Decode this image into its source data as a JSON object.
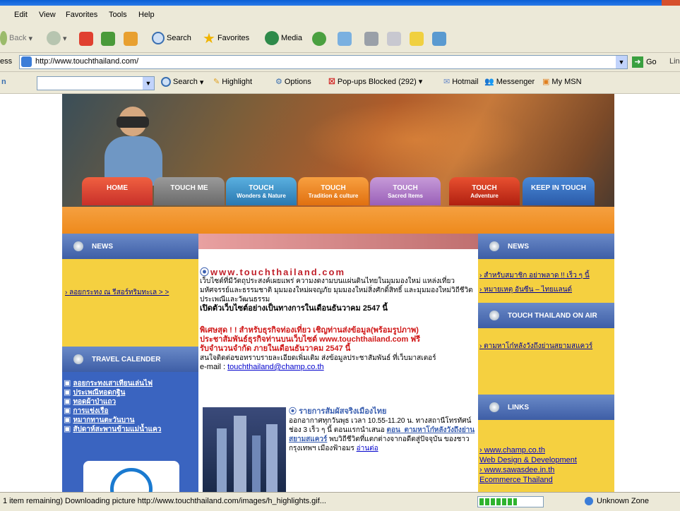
{
  "menu": [
    "Edit",
    "View",
    "Favorites",
    "Tools",
    "Help"
  ],
  "toolbar": {
    "back": "Back",
    "search": "Search",
    "favorites": "Favorites",
    "media": "Media"
  },
  "address": {
    "label": "ess",
    "url": "http://www.touchthailand.com/",
    "go": "Go",
    "links": "Lin"
  },
  "searchbar": {
    "search": "Search",
    "highlight": "Highlight",
    "options": "Options",
    "popups": "Pop-ups Blocked (292)",
    "hotmail": "Hotmail",
    "messenger": "Messenger",
    "mymsn": "My MSN"
  },
  "site": {
    "nav": [
      {
        "label": "HOME",
        "sub": ""
      },
      {
        "label": "TOUCH  ME",
        "sub": ""
      },
      {
        "label": "TOUCH",
        "sub": "Wonders & Nature"
      },
      {
        "label": "TOUCH",
        "sub": "Tradition & culture"
      },
      {
        "label": "TOUCH",
        "sub": "Sacred Items"
      },
      {
        "label": "TOUCH",
        "sub": "Adventure"
      },
      {
        "label": "KEEP IN TOUCH",
        "sub": ""
      }
    ],
    "left": {
      "news_title": "NEWS",
      "news_link": "ลอยกระทง ณ รีสอร์ทริมทะเล > >",
      "travel_title": "TRAVEL CALENDER",
      "travel_items": [
        "ลอยกระทงเสาเทียนเล่นไฟ",
        "ประเพณีทอดกฐิน",
        "ทอดผ้าป่าแถว",
        "การแข่งเรือ",
        "หมากทานตะวันบาน",
        "สัปดาห์สะพานข้ามแม่น้ำแคว"
      ]
    },
    "center": {
      "site_title": "www.touchthailand.com",
      "intro": "เว็บไซต์ที่มีวัตถุประสงค์เผยแพร่ ความงดงามบนแผ่นดินไทยในมุมมองใหม่ แหล่งเที่ยวมหัศจรรย์และธรรมชาติ มุมมองใหม่ผจญภัย มุมมองใหม่สิ่งศักดิ์สิทธิ์ และมุมมองใหม่วิถีชีวิตประเพณีและวัฒนธรรม",
      "open_notice": "เปิดตัวเว็บไซต์อย่างเป็นทางการในเดือนธันวาคม 2547 นี้",
      "special_1": "พิเศษสุด ! ! สำหรับธุรกิจท่องเที่ยว เชิญท่านส่งข้อมูล(พร้อมรูปภาพ)",
      "special_2": "ประชาสัมพันธ์ธุรกิจท่านบนเว็บไซต์ www.touchthailand.com ฟรี",
      "special_3": "รับจำนวนจำกัด ภายในเดือนธันวาคม 2547 นี้",
      "contact": "สนใจติดต่อขอทราบรายละเอียดเพิ่มเติม ส่งข้อมูลประชาสัมพันธ์ ที่เว็บมาสเตอร์",
      "email_label": "e-mail : ",
      "email": "touchthailand@champ.co.th",
      "program_title": "รายการสัมผัสจริงเมืองไทย",
      "program_text": "ออกอากาศทุกวันพุธ เวลา 10.55-11.20 น. ทางสถานีโทรทัศน์ช่อง 3 เร็ว ๆ นี้ ตอนแรกนำเสนอ",
      "program_link": "ตอน_ตามหาโก๋หลังวังถึงย่านสยามสแควร์",
      "program_text2": "พบวิถีชีวิตที่แตกต่างจากอดีตสู่ปัจจุบัน ของชาวกรุงเทพฯ เมืองฟ้าอมร",
      "read_more": "อ่านต่อ"
    },
    "right": {
      "news_title": "NEWS",
      "news_items": [
        "สำหรับสมาชิก อย่าพลาด !! เร็ว ๆ นี้",
        "หมายเหตุ อันซีน – ไทยแลนด์"
      ],
      "onair_title": "TOUCH THAILAND ON AIR",
      "onair_link": "ตามหาโก๋หลังวังถึงย่านสยามสแควร์",
      "links_title": "LINKS",
      "links": [
        {
          "url": "www.champ.co.th",
          "desc": "Web Design & Development"
        },
        {
          "url": "www.sawasdee.in.th",
          "desc": "Ecommerce Thailand"
        }
      ]
    }
  },
  "status": {
    "text": "1 item remaining) Downloading picture http://www.touchthailand.com/images/h_highlights.gif...",
    "progress": 0.6,
    "zone": "Unknown Zone"
  }
}
